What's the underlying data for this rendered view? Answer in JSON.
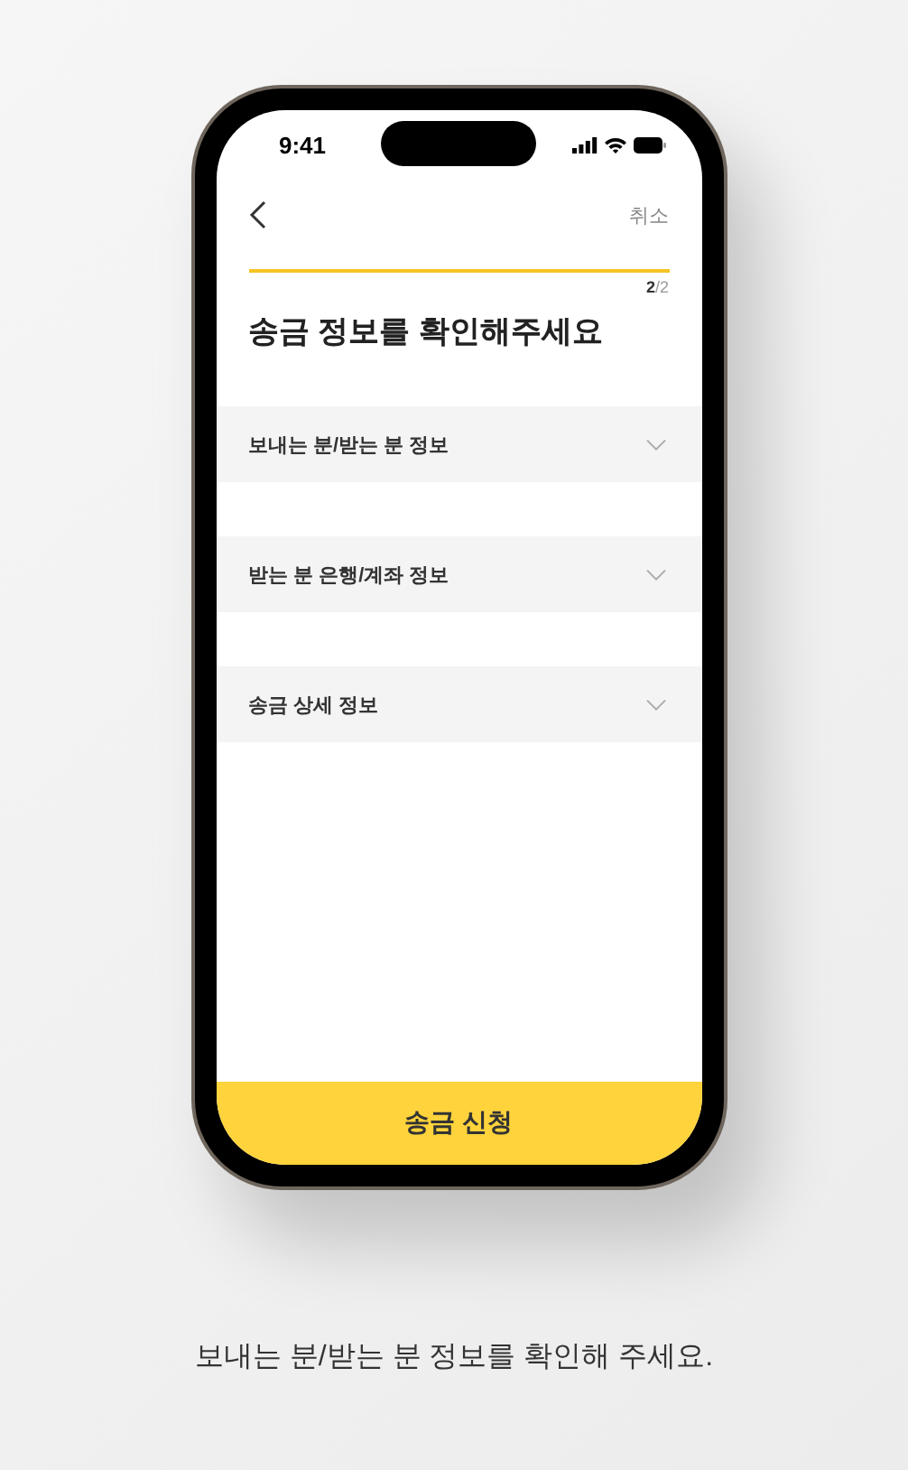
{
  "status_bar": {
    "time": "9:41"
  },
  "header": {
    "cancel": "취소"
  },
  "progress": {
    "level": 1,
    "step": "**2**/2"
  },
  "title": "송금 정보를 확인해주세요",
  "sections": [
    {
      "label": "보내는 분/받는 분 정보",
      "expanded": false
    },
    {
      "label": "받는 분 은행/계좌 정보",
      "expanded": false
    },
    {
      "label": "송금 상세 정보",
      "expanded": false
    }
  ],
  "submit_button": "송금 신청",
  "caption": "보내는 분/받는 분 정보를 확인해 주세요."
}
